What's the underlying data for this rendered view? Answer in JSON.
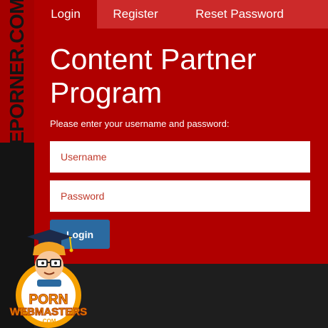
{
  "brand": {
    "vertical_logo": "EPORNER.COM"
  },
  "tabs": [
    {
      "label": "Login",
      "active": true
    },
    {
      "label": "Register",
      "active": false
    },
    {
      "label": "Reset Password",
      "active": false
    }
  ],
  "main": {
    "title": "Content Partner Program",
    "instructions": "Please enter your username and password:"
  },
  "form": {
    "username_placeholder": "Username",
    "password_placeholder": "Password",
    "login_label": "Login"
  },
  "badge": {
    "line1": "PORN",
    "line2": "WEBMASTERS",
    "line3": ".COM"
  },
  "colors": {
    "panel": "#b00000",
    "tabbar": "#cc2a2a",
    "background": "#1e1e1e",
    "button": "#2b6aa0"
  }
}
